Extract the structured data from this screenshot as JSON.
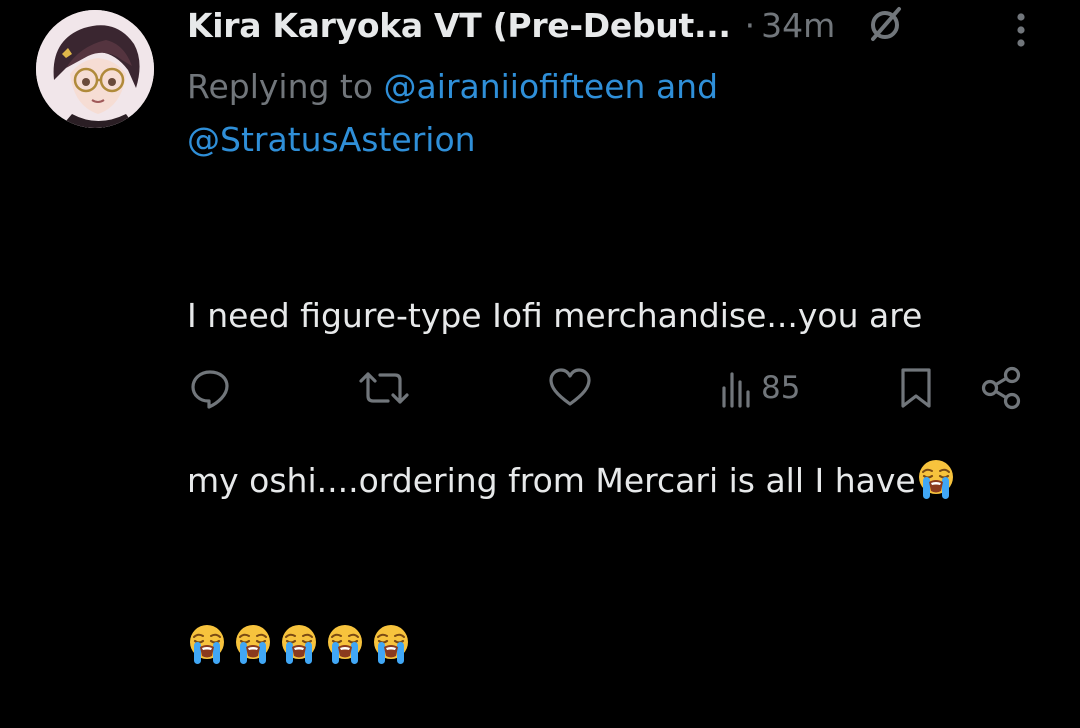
{
  "tweet": {
    "author_name": "Kira Karyoka VT (Pre-Debut...",
    "separator": "·",
    "time": "34m",
    "reply_prefix": "Replying to ",
    "reply_mention_1": "@airaniiofifteen",
    "reply_and": " and",
    "reply_mention_2": "@StratusAsterion",
    "text_line_1": "I need figure-type Iofi merchandise...you are",
    "text_line_2": "my oshi....ordering from Mercari is all I have",
    "emoji_name": "loudly-crying-face",
    "emoji_trailing_count": 1,
    "emoji_row_count": 5
  },
  "actions": {
    "views": "85"
  },
  "colors": {
    "background": "#000000",
    "text": "#e7e9ea",
    "secondary": "#71767b",
    "link": "#1d9bf0"
  }
}
